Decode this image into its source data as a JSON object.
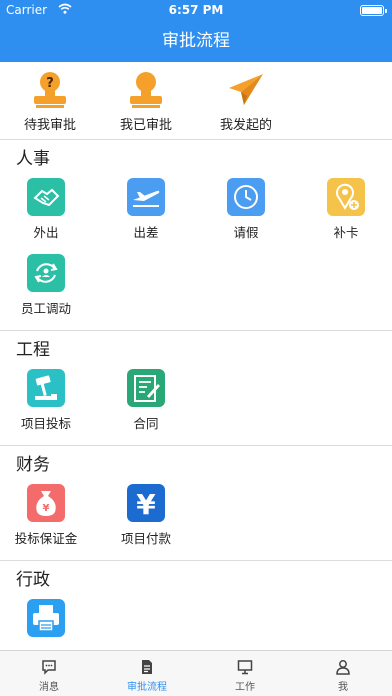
{
  "status_bar": {
    "carrier": "Carrier",
    "time": "6:57 PM"
  },
  "nav": {
    "title": "审批流程"
  },
  "quick_actions": [
    {
      "label": "待我审批",
      "icon": "stamp-question-icon",
      "color": "#f5a02a"
    },
    {
      "label": "我已审批",
      "icon": "stamp-icon",
      "color": "#f5a02a"
    },
    {
      "label": "我发起的",
      "icon": "paper-plane-icon",
      "color": "#f5a02a"
    }
  ],
  "sections": [
    {
      "title": "人事",
      "items": [
        {
          "label": "外出",
          "icon": "handshake-icon",
          "color": "#2bbfa6"
        },
        {
          "label": "出差",
          "icon": "airplane-icon",
          "color": "#4a9df0"
        },
        {
          "label": "请假",
          "icon": "clock-icon",
          "color": "#4a9df0"
        },
        {
          "label": "补卡",
          "icon": "location-pin-icon",
          "color": "#f5c24a"
        },
        {
          "label": "员工调动",
          "icon": "transfer-icon",
          "color": "#2bbfa6"
        }
      ]
    },
    {
      "title": "工程",
      "items": [
        {
          "label": "项目投标",
          "icon": "gavel-icon",
          "color": "#2bbfc6"
        },
        {
          "label": "合同",
          "icon": "contract-icon",
          "color": "#2aa776"
        }
      ]
    },
    {
      "title": "财务",
      "items": [
        {
          "label": "投标保证金",
          "icon": "money-bag-icon",
          "color": "#f46b6b"
        },
        {
          "label": "项目付款",
          "icon": "yen-icon",
          "color": "#1c6bd1"
        }
      ]
    },
    {
      "title": "行政",
      "items": [
        {
          "label": "",
          "icon": "printer-icon",
          "color": "#2b9ff0"
        }
      ]
    }
  ],
  "tabs": [
    {
      "label": "消息",
      "icon": "message-icon",
      "active": false
    },
    {
      "label": "审批流程",
      "icon": "document-icon",
      "active": true
    },
    {
      "label": "工作",
      "icon": "monitor-icon",
      "active": false
    },
    {
      "label": "我",
      "icon": "person-icon",
      "active": false
    }
  ],
  "colors": {
    "primary": "#2f8ff0"
  }
}
